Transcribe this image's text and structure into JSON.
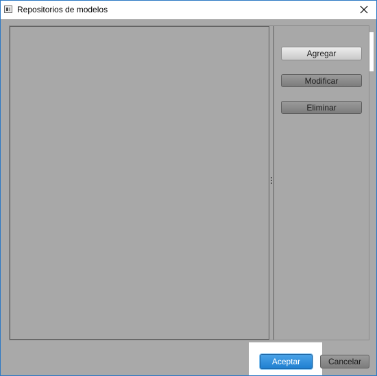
{
  "window": {
    "title": "Repositorios de modelos"
  },
  "toolbar": {
    "add_label": "Agregar",
    "modify_label": "Modificar",
    "delete_label": "Eliminar"
  },
  "footer": {
    "accept_label": "Aceptar",
    "cancel_label": "Cancelar"
  },
  "icons": {
    "app": "window-app-icon",
    "close": "close-icon",
    "splitter": "splitter-grip-icon"
  },
  "colors": {
    "accent": "#1f7fd0",
    "window_border": "#2b78c4",
    "background": "#a9a9a9"
  }
}
